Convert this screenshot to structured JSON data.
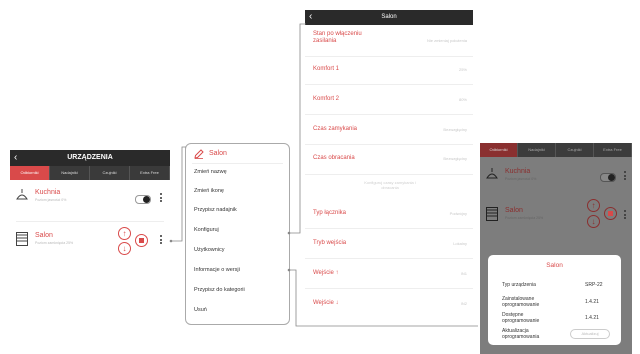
{
  "phone": {
    "title": "URZĄDZENIA",
    "tabs": [
      "Odbiorniki",
      "Nadajniki",
      "Czujniki",
      "Extra Free"
    ],
    "devices": [
      {
        "name": "Kuchnia",
        "status": "Poziom jasności 0%"
      },
      {
        "name": "Salon",
        "status": "Poziom zamknięcia 25%"
      }
    ]
  },
  "menu": {
    "title": "Salon",
    "items": [
      "Zmień nazwę",
      "Zmień ikonę",
      "Przypisz nadajnik",
      "Konfiguruj",
      "Użytkownicy",
      "Informacje o wersji",
      "Przypisz do kategorii",
      "Usuń"
    ]
  },
  "settings": {
    "title": "Salon",
    "rows": [
      {
        "label": "Stan po włączeniu zasilania",
        "value": "Nie zmieniaj położenia"
      },
      {
        "label": "Komfort 1",
        "value": "25%"
      },
      {
        "label": "Komfort 2",
        "value": "80%"
      },
      {
        "label": "Czas zamykania",
        "value": "Bezwzględny"
      },
      {
        "label": "Czas obracania",
        "value": "Bezwzględny"
      },
      {
        "label": "Typ łącznika",
        "value": "Podwójny"
      },
      {
        "label": "Tryb wejścia",
        "value": "Lokalny"
      },
      {
        "label": "Wejście ↑",
        "value": "IN1"
      },
      {
        "label": "Wejście ↓",
        "value": "IN2"
      }
    ],
    "note": "Konfiguruj czasy zamykania i obracania"
  },
  "dimmed": {
    "tabs": [
      "Odbiorniki",
      "Nadajniki",
      "Czujniki",
      "Extra Free"
    ],
    "devices": [
      {
        "name": "Kuchnia",
        "status": "Poziom jasności 0%"
      },
      {
        "name": "Salon",
        "status": "Poziom zamknięcia 25%"
      }
    ]
  },
  "dialog": {
    "title": "Salon",
    "rows": [
      {
        "label": "Typ urządzenia",
        "value": "SRP-22"
      },
      {
        "label": "Zainstalowane oprogramowanie",
        "value": "1.4.21"
      },
      {
        "label": "Dostępne oprogramowanie",
        "value": "1.4.21"
      },
      {
        "label": "Aktualizacja oprogramowania",
        "value": "Aktualizuj"
      }
    ]
  },
  "colors": {
    "accent": "#d94a4a",
    "header": "#2a2a2a",
    "overlay": "#7d7d7d"
  }
}
